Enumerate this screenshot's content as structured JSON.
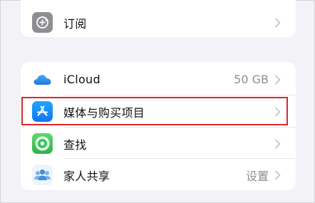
{
  "settings": {
    "subscriptions": {
      "label": "订阅",
      "icon": "subscription-icon"
    },
    "items": [
      {
        "label": "iCloud",
        "value": "50 GB",
        "icon": "icloud-icon"
      },
      {
        "label": "媒体与购买项目",
        "value": "",
        "icon": "app-store-icon"
      },
      {
        "label": "查找",
        "value": "",
        "icon": "find-my-icon"
      },
      {
        "label": "家人共享",
        "value": "设置",
        "icon": "family-sharing-icon"
      }
    ]
  },
  "colors": {
    "background": "#f2f2f7",
    "highlight": "#e0262a",
    "app_store_blue": "#1a8cff",
    "find_my_green": "#34c759"
  }
}
